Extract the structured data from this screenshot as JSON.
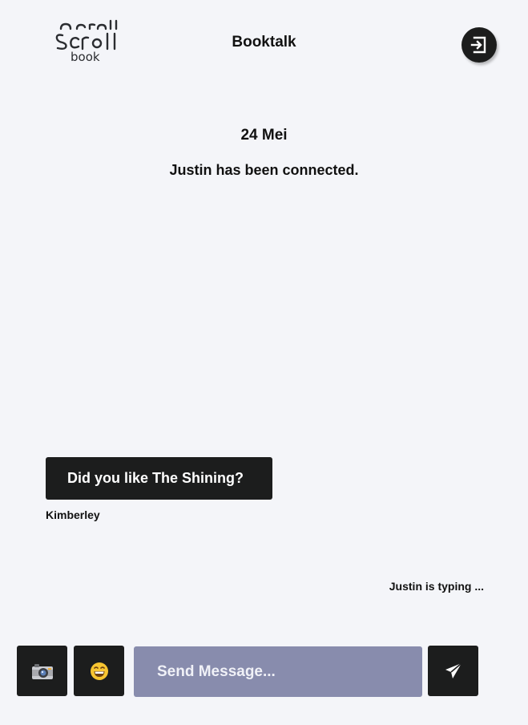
{
  "header": {
    "logo_text": "Scroll Scroll book",
    "title": "Booktalk",
    "exit_icon": "exit-icon"
  },
  "chat": {
    "date": "24 Mei",
    "status": "Justin has been connected.",
    "messages": [
      {
        "text": "Did you like The Shining?",
        "sender": "Kimberley"
      }
    ],
    "typing": "Justin is typing ..."
  },
  "composer": {
    "camera_icon": "camera-icon",
    "emoji_icon": "grinning-face-icon",
    "placeholder": "Send Message...",
    "value": "",
    "send_icon": "paper-plane-icon"
  },
  "colors": {
    "background": "#f4f5f9",
    "dark": "#1c1d1d",
    "input": "#888cad"
  }
}
